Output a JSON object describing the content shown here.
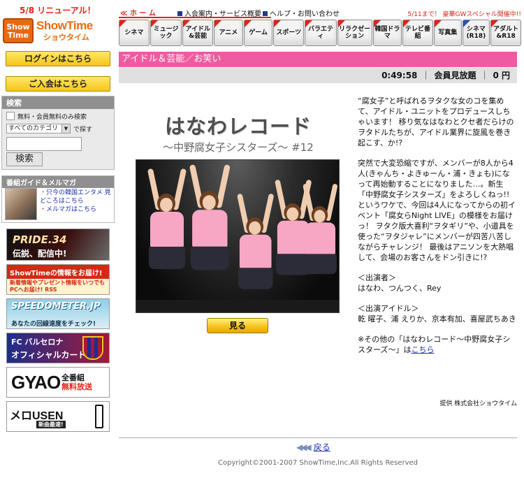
{
  "header": {
    "renewal": "5/8 リニューアル！",
    "logo_badge": "Show Time",
    "logo_name": "ShowTime",
    "logo_kana": "ショウタイム",
    "home": "≪ ホ ー ム",
    "nav": [
      {
        "label": "入会案内・サービス概要"
      },
      {
        "label": "ヘルプ・お問い合わせ"
      }
    ],
    "promo": "5/11まで！ 豪華GWスペシャル開催中!!"
  },
  "genres": [
    {
      "label": "シネマ",
      "color": "red"
    },
    {
      "label": "ミュージック",
      "color": "red"
    },
    {
      "label": "アイドル\n&芸能",
      "color": "red"
    },
    {
      "label": "アニメ",
      "color": "red"
    },
    {
      "label": "ゲーム",
      "color": "red"
    },
    {
      "label": "スポーツ",
      "color": "red"
    },
    {
      "label": "バラエティ",
      "color": "red"
    },
    {
      "label": "リラクゼーション",
      "color": "red"
    },
    {
      "label": "韓国ドラマ",
      "color": "red"
    },
    {
      "label": "テレビ番組",
      "color": "red"
    },
    {
      "label": "写真集",
      "color": "red"
    },
    {
      "label": "シネマ\n(R18)",
      "color": "blue"
    },
    {
      "label": "アダルト\n&R18",
      "color": "red"
    }
  ],
  "sidebar": {
    "login": "ログインはこちら",
    "join": "ご入会はこちら",
    "search": {
      "title": "検索",
      "free_only": "無料・会員無料のみ検索",
      "category": "すべてのカテゴリ",
      "search_suffix": "で探す",
      "keyword_value": "",
      "button": "検索"
    },
    "guide": {
      "title": "番組ガイド＆メルマガ",
      "links": [
        "只今の韓国エンタメ 見どころはこちら",
        "メルマガはこちら"
      ]
    },
    "banners": {
      "pride_title": "PRIDE.34",
      "pride_sub": "伝説、配信中!",
      "info_title": "ShowTimeの情報をお届け!",
      "info_body": "新着情報やプレゼント情報をいつでもPCへお届け! RSS",
      "speed_title": "SPEEDOMETER.JP",
      "speed_sub": "あなたの回線速度をチェック!",
      "fcb_title": "FC バルセロナ",
      "fcb_sub": "オフィシャルカード",
      "gyao_title": "GYAO",
      "gyao_line1": "全番組",
      "gyao_line2": "無料放送",
      "usen_title": "メロUSEN",
      "usen_sub": "新曲最速!"
    }
  },
  "main": {
    "category": "アイドル＆芸能／お笑い",
    "duration": "0:49:58",
    "price_type": "会員見放題",
    "price": "0 円",
    "title": "はなわレコード",
    "subtitle": "〜中野腐女子シスターズ〜 #12",
    "watch_button": "見る",
    "description": [
      "“腐女子”と呼ばれるヲタクな女のコを集めて、アイドル・ユニットをプロデュースしちゃいます！ 移り気なはなわとクセ者だらけのヲタドルたちが、アイドル業界に旋風を巻き起こす、か!?",
      "突然で大変恐縮ですが、メンバーが8人から4人(きゃんち・よきゅーん・浦・きょも)になって再始動することになりました…。新生「中野腐女子シスターズ」をよろしくねっ!! というワケで、今回は4人になってからの初イベント「腐女らNight LIVE」の模様をお届けっ！ ヲタク版大喜利“ヲタギリ”や、小道具を使った“ヲタジャレ”にメンバーが四苦八苦しながらチャレンジ！ 最後はアニソンを大熱唱して、会場のお客さんをドン引きに!?",
      "＜出演者＞\nはなわ、つんつく、Rey",
      "＜出演アイドル＞\n乾 曜子、浦 えりか、京本有加、喜屋武ちあき"
    ],
    "other_prefix": "※その他の「はなわレコード〜中野腐女子シスターズ〜」は",
    "other_link": "こちら",
    "provider": "提供 株式会社ショウタイム",
    "back": "戻る",
    "copyright": "Copyright©2001-2007 ShowTime,Inc.All Rights Reserved"
  }
}
